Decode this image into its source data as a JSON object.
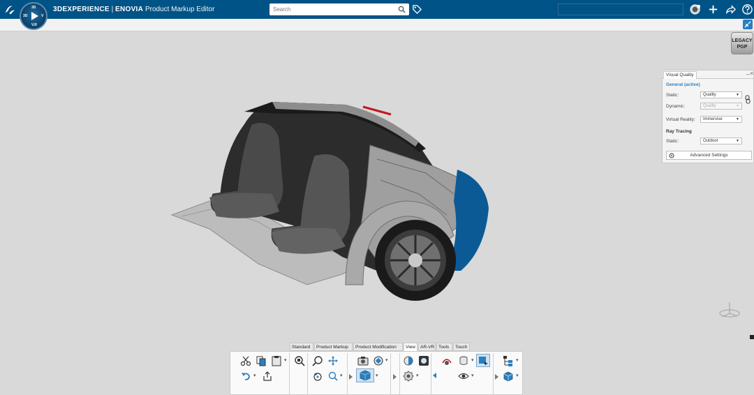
{
  "header": {
    "brand_prefix": "3DEXPERIENCE",
    "separator": " | ",
    "brand_name": "ENOVIA",
    "app_name": "Product Markup Editor",
    "search_placeholder": "Search",
    "compass_labels": {
      "top": "3D",
      "left": "3D",
      "right": "V",
      "bottom": "V.R"
    }
  },
  "legacy_badge": {
    "line1": "LEGACY",
    "line2": "PGP"
  },
  "visual_quality": {
    "tab_title": "Visual Quality",
    "general_section": "General (active)",
    "static_label": "Static:",
    "static_value": "Quality",
    "dynamic_label": "Dynamic:",
    "dynamic_value": "Quality",
    "vr_label": "Virtual Reality:",
    "vr_value": "Immersive",
    "ray_section": "Ray Tracing",
    "ray_static_label": "Static:",
    "ray_static_value": "Outdoor",
    "advanced_label": "Advanced Settings"
  },
  "action_bar": {
    "tabs": [
      "Standard",
      "Product Markup",
      "Product Modification",
      "View",
      "AR-VR",
      "Tools",
      "Touch"
    ],
    "active_tab": "View"
  },
  "colors": {
    "topbar": "#005386",
    "accent": "#2a7fc0",
    "section_header": "#2a7fc0",
    "car_panel_blue": "#0b5a96"
  },
  "icons": [
    "3ds-logo-icon",
    "compass-icon",
    "search-icon",
    "tag-icon",
    "user-avatar-icon",
    "add-icon",
    "share-icon",
    "help-icon",
    "collapse-icon",
    "cut-icon",
    "copy-icon",
    "paste-icon",
    "undo-icon",
    "export-icon",
    "zoom-icon",
    "pan-icon",
    "rotate-icon",
    "camera-icon",
    "render-icon",
    "view-cube-icon",
    "light-icon",
    "link-icon",
    "gear-icon"
  ]
}
